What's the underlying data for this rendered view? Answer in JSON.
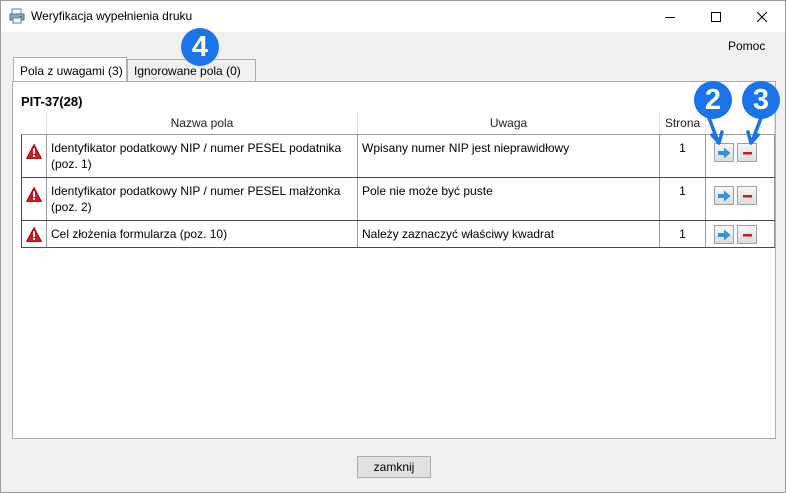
{
  "window": {
    "title": "Weryfikacja wypełnienia druku"
  },
  "menu": {
    "help": "Pomoc"
  },
  "tabs": [
    {
      "label": "Pola z uwagami (3)",
      "active": true
    },
    {
      "label": "Ignorowane pola (0)",
      "active": false
    }
  ],
  "document": {
    "heading": "PIT-37(28)"
  },
  "table": {
    "headers": {
      "name": "Nazwa pola",
      "note": "Uwaga",
      "page": "Strona"
    },
    "rows": [
      {
        "name_line1": "Identyfikator podatkowy NIP / numer PESEL podatnika",
        "name_line2": "(poz. 1)",
        "note": "Wpisany numer NIP jest nieprawidłowy",
        "page": "1"
      },
      {
        "name_line1": "Identyfikator podatkowy NIP / numer PESEL małżonka",
        "name_line2": "(poz. 2)",
        "note": "Pole nie może być puste",
        "page": "1"
      },
      {
        "name_line1": "Cel złożenia formularza (poz. 10)",
        "name_line2": "",
        "note": "Należy zaznaczyć właściwy kwadrat",
        "page": "1"
      }
    ]
  },
  "annotations": {
    "badge_tab": "4",
    "badge_go": "2",
    "badge_ignore": "3"
  },
  "footer": {
    "close_label": "zamknij"
  },
  "colors": {
    "badge": "#1a73e8",
    "warning": "#d9161c",
    "goto_arrow": "#3a8fd6",
    "ignore_minus": "#cc1a1a"
  }
}
